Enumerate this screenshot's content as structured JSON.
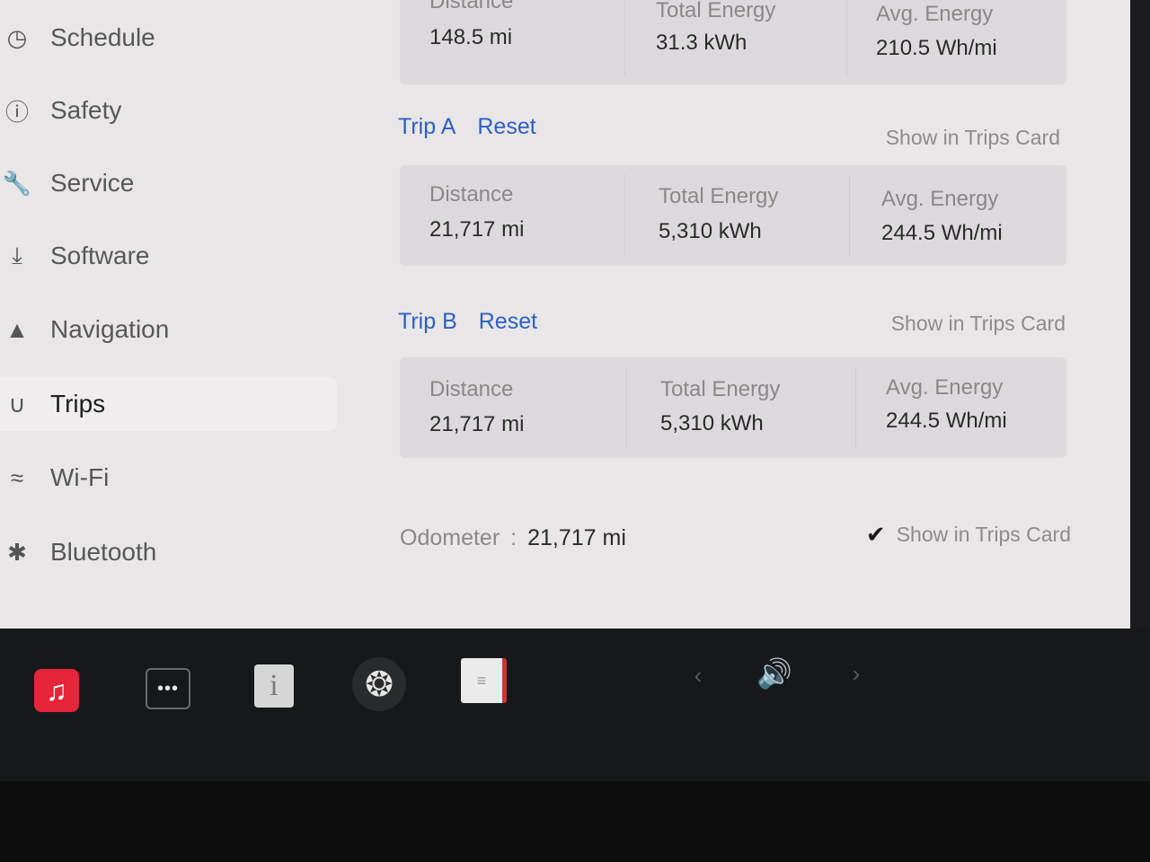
{
  "sidebar": {
    "items": [
      {
        "label": "Schedule",
        "icon": "clock-icon"
      },
      {
        "label": "Safety",
        "icon": "alert-circle-icon"
      },
      {
        "label": "Service",
        "icon": "wrench-icon"
      },
      {
        "label": "Software",
        "icon": "download-icon"
      },
      {
        "label": "Navigation",
        "icon": "navigation-arrow-icon"
      },
      {
        "label": "Trips",
        "icon": "trips-icon",
        "active": true
      },
      {
        "label": "Wi-Fi",
        "icon": "wifi-icon"
      },
      {
        "label": "Bluetooth",
        "icon": "bluetooth-icon"
      }
    ]
  },
  "top_card": {
    "distance_label": "Distance",
    "distance_value": "148.5  mi",
    "energy_label": "Total Energy",
    "energy_value": "31.3  kWh",
    "avg_label": "Avg. Energy",
    "avg_value": "210.5  Wh/mi"
  },
  "trip_a": {
    "name": "Trip A",
    "reset": "Reset",
    "show_card": "Show in Trips Card",
    "distance_label": "Distance",
    "distance_value": "21,717  mi",
    "energy_label": "Total Energy",
    "energy_value": "5,310  kWh",
    "avg_label": "Avg. Energy",
    "avg_value": "244.5  Wh/mi"
  },
  "trip_b": {
    "name": "Trip B",
    "reset": "Reset",
    "show_card": "Show in Trips Card",
    "distance_label": "Distance",
    "distance_value": "21,717  mi",
    "energy_label": "Total Energy",
    "energy_value": "5,310  kWh",
    "avg_label": "Avg. Energy",
    "avg_value": "244.5  Wh/mi"
  },
  "odometer": {
    "label": "Odometer",
    "separator": ":",
    "value": "21,717  mi",
    "show_card": "Show in Trips Card",
    "show_card_checked": true
  },
  "dock": {
    "music_icon": "music-note-icon",
    "more_icon": "more-dots-icon",
    "manual_icon": "owners-manual-icon",
    "fan_icon": "fan-icon",
    "notes_icon": "notes-icon",
    "prev_icon": "chevron-left-icon",
    "volume_icon": "volume-icon",
    "next_icon": "chevron-right-icon"
  },
  "colors": {
    "accent": "#2d5fc4",
    "screen_bg": "#e9e6e8",
    "card_bg": "#dcd9dc",
    "music_red": "#e4253a"
  }
}
